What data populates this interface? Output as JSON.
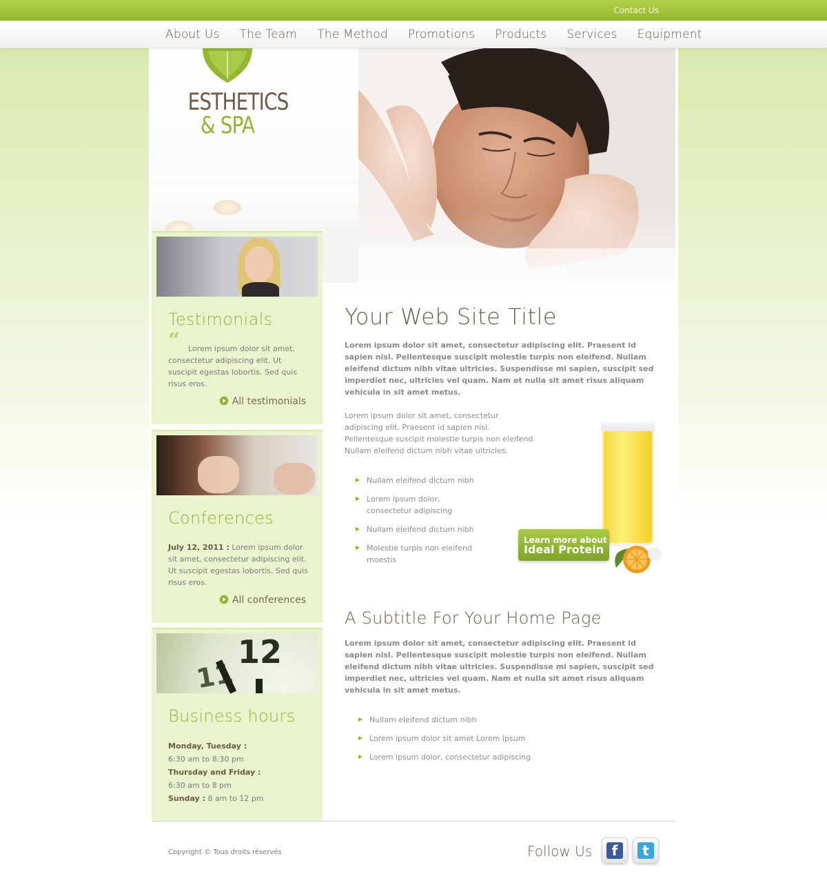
{
  "topbar": {
    "contact_label": "Contact Us"
  },
  "nav": {
    "items": [
      "About Us",
      "The Team",
      "The Method",
      "Promotions",
      "Products",
      "Services",
      "Equipment"
    ]
  },
  "logo": {
    "line1": "ESTHETICS",
    "line2": "& SPA"
  },
  "sidebar": {
    "testimonials": {
      "title": "Testimonials",
      "text": "Lorem ipsum dolor sit amet, consectetur adipiscing elit. Ut suscipit egestas lobortis. Sed quis risus eros.",
      "link": "All testimonials"
    },
    "conferences": {
      "title": "Conferences",
      "date": "July 12, 2011 :",
      "text": " Lorem ipsum dolor sit amet, consectetur adipiscing elit. Ut suscipit egestas lobortis. Sed quis risus eros.",
      "link": "All conferences"
    },
    "hours": {
      "title": "Business hours",
      "rows": [
        {
          "day": "Monday, Tuesday :",
          "time": "6:30 am to 8:30 pm"
        },
        {
          "day": "Thursday and Friday :",
          "time": "6:30 am to 8 pm"
        },
        {
          "day": "Sunday :",
          "time": " 8 am to 12 pm"
        }
      ]
    },
    "clock_number": "12"
  },
  "main": {
    "title": "Your Web Site Title",
    "lead": "Lorem ipsum dolor sit amet, consectetur adipiscing elit. Praesent id sapien nisl. Pellentesque suscipit molestie turpis non eleifend. Nullam eleifend dictum nibh vitae ultricies. Suspendisse mi sapien, suscipit sed imperdiet nec, ultricies vel quam. Nam et nulla sit amet risus aliquam vehicula in sit amet metus.",
    "para": "Lorem ipsum dolor sit amet, consectetur adipiscing elit. Praesent id sapien nisl. Pellentesque suscipit molestie turpis non eleifend. Nullam eleifend dictum nibh vitae ultricies.",
    "bullets": [
      "Nullam eleifend dictum nibh",
      "Lorem ipsum dolor, consectetur adipiscing",
      "Nullam eleifend dictum nibh",
      "Molestie turpis non eleifend moestis"
    ],
    "subtitle": "A Subtitle For Your Home Page",
    "lead2": "Lorem ipsum dolor sit amet, consectetur adipiscing elit. Praesent id sapien nisl. Pellentesque suscipit molestie turpis non eleifend. Nullam eleifend dictum nibh vitae ultricies. Suspendisse mi sapien, suscipit sed imperdiet nec, ultricies vel quam. Nam et nulla sit amet risus aliquam vehicula in sit amet metus.",
    "bullets2": [
      "Nullam eleifend dictum nibh",
      "Lorem ipsum dolor sit amet Lorem ipsum",
      "Lorem ipsum dolor, consectetur adipiscing"
    ]
  },
  "promo": {
    "line1": "Learn more about",
    "line2": "Ideal Protein"
  },
  "footer": {
    "copyright": "Copyright © Tous droits réservés",
    "follow": "Follow Us",
    "facebook": "f",
    "twitter": "t"
  },
  "colors": {
    "accent": "#93b631",
    "brown": "#6d5a48",
    "sidebar_bg": "#e9f4ce"
  }
}
